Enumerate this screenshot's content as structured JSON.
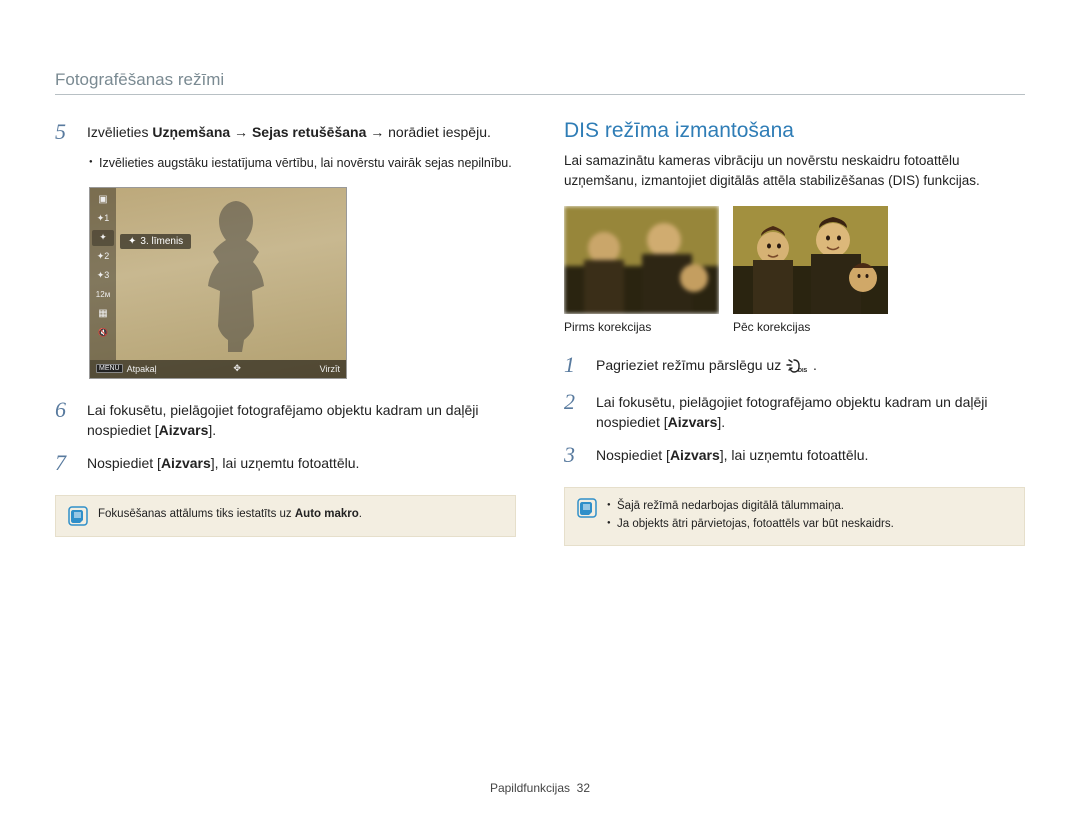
{
  "header": {
    "section": "Fotografēšanas režīmi"
  },
  "left": {
    "step5": {
      "num": "5",
      "text_pre": "Izvēlieties ",
      "bold1": "Uzņemšana",
      "arrow1": " → ",
      "bold2": "Sejas retušēšana",
      "arrow2": " → ",
      "text_post": "norādiet iespēju.",
      "bullet": "Izvēlieties augstāku iestatījuma vērtību, lai novērstu vairāk sejas nepilnību."
    },
    "screen": {
      "level_label": "3. līmenis",
      "menu": "MENU",
      "back": "Atpakaļ",
      "move": "Virzīt"
    },
    "step6": {
      "num": "6",
      "text_pre": "Lai fokusētu, pielāgojiet fotografējamo objektu kadram un daļēji nospiediet [",
      "bold": "Aizvars",
      "text_post": "]."
    },
    "step7": {
      "num": "7",
      "text_pre": "Nospiediet [",
      "bold": "Aizvars",
      "text_post": "], lai uzņemtu fotoattēlu."
    },
    "note": {
      "text_pre": "Fokusēšanas attālums tiks iestatīts uz ",
      "bold": "Auto makro",
      "text_post": "."
    }
  },
  "right": {
    "title": "DIS režīma izmantošana",
    "intro": "Lai samazinātu kameras vibrāciju un novērstu neskaidru fotoattēlu uzņemšanu, izmantojiet digitālās attēla stabilizēšanas (DIS) funkcijas.",
    "caption_before": "Pirms korekcijas",
    "caption_after": "Pēc korekcijas",
    "step1": {
      "num": "1",
      "text_pre": "Pagrieziet režīmu pārslēgu uz ",
      "text_post": "."
    },
    "step2": {
      "num": "2",
      "text_pre": "Lai fokusētu, pielāgojiet fotografējamo objektu kadram un daļēji nospiediet [",
      "bold": "Aizvars",
      "text_post": "]."
    },
    "step3": {
      "num": "3",
      "text_pre": "Nospiediet [",
      "bold": "Aizvars",
      "text_post": "], lai uzņemtu fotoattēlu."
    },
    "note": {
      "b1": "Šajā režīmā nedarbojas digitālā tālummaiņa.",
      "b2": "Ja objekts ātri pārvietojas, fotoattēls var būt neskaidrs."
    }
  },
  "footer": {
    "label": "Papildfunkcijas",
    "page": "32"
  }
}
